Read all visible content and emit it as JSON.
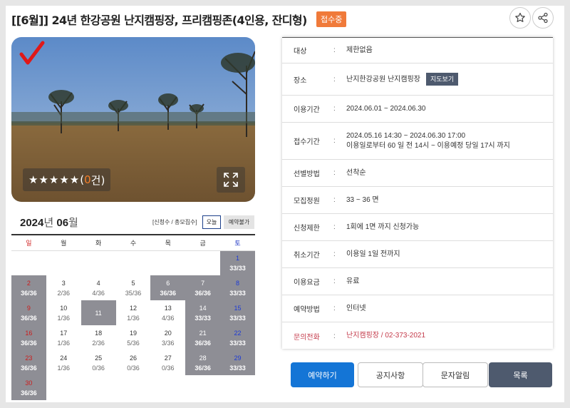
{
  "title": "[[6월]] 24년 한강공원 난지캠핑장, 프리캠핑존(4인용, 잔디형)",
  "status_badge": "접수중",
  "rating": {
    "stars": "★★★★★",
    "open": "(",
    "count": "0",
    "close": " 건)"
  },
  "calendar": {
    "year": "2024",
    "year_suffix": "년",
    "month": "06",
    "month_suffix": "월",
    "legend": "[신청수 / 총모집수]",
    "today_btn": "오늘",
    "unavailable_btn": "예약불가",
    "weekdays": [
      "일",
      "월",
      "화",
      "수",
      "목",
      "금",
      "토"
    ],
    "weeks": [
      [
        {
          "d": "",
          "c": "",
          "g": false
        },
        {
          "d": "",
          "c": "",
          "g": false
        },
        {
          "d": "",
          "c": "",
          "g": false
        },
        {
          "d": "",
          "c": "",
          "g": false
        },
        {
          "d": "",
          "c": "",
          "g": false
        },
        {
          "d": "",
          "c": "",
          "g": false
        },
        {
          "d": "1",
          "c": "33/33",
          "g": true
        }
      ],
      [
        {
          "d": "2",
          "c": "36/36",
          "g": true
        },
        {
          "d": "3",
          "c": "2/36",
          "g": false
        },
        {
          "d": "4",
          "c": "4/36",
          "g": false
        },
        {
          "d": "5",
          "c": "35/36",
          "g": false
        },
        {
          "d": "6",
          "c": "36/36",
          "g": true
        },
        {
          "d": "7",
          "c": "36/36",
          "g": true
        },
        {
          "d": "8",
          "c": "33/33",
          "g": true
        }
      ],
      [
        {
          "d": "9",
          "c": "36/36",
          "g": true
        },
        {
          "d": "10",
          "c": "1/36",
          "g": false
        },
        {
          "d": "11",
          "c": "",
          "g": true
        },
        {
          "d": "12",
          "c": "1/36",
          "g": false
        },
        {
          "d": "13",
          "c": "4/36",
          "g": false
        },
        {
          "d": "14",
          "c": "33/33",
          "g": true
        },
        {
          "d": "15",
          "c": "33/33",
          "g": true
        }
      ],
      [
        {
          "d": "16",
          "c": "36/36",
          "g": true
        },
        {
          "d": "17",
          "c": "1/36",
          "g": false
        },
        {
          "d": "18",
          "c": "2/36",
          "g": false
        },
        {
          "d": "19",
          "c": "5/36",
          "g": false
        },
        {
          "d": "20",
          "c": "3/36",
          "g": false
        },
        {
          "d": "21",
          "c": "36/36",
          "g": true
        },
        {
          "d": "22",
          "c": "33/33",
          "g": true
        }
      ],
      [
        {
          "d": "23",
          "c": "36/36",
          "g": true
        },
        {
          "d": "24",
          "c": "1/36",
          "g": false
        },
        {
          "d": "25",
          "c": "0/36",
          "g": false
        },
        {
          "d": "26",
          "c": "0/36",
          "g": false
        },
        {
          "d": "27",
          "c": "0/36",
          "g": false
        },
        {
          "d": "28",
          "c": "36/36",
          "g": true
        },
        {
          "d": "29",
          "c": "33/33",
          "g": true
        }
      ],
      [
        {
          "d": "30",
          "c": "36/36",
          "g": true
        }
      ]
    ]
  },
  "info": {
    "separator": ":",
    "target_label": "대상",
    "target_value": "제한없음",
    "place_label": "장소",
    "place_value": "난지한강공원 난지캠핑장",
    "map_btn": "지도보기",
    "period_label": "이용기간",
    "period_value": "2024.06.01 ~ 2024.06.30",
    "apply_label": "접수기간",
    "apply_value_1": "2024.05.16 14:30 ~ 2024.06.30 17:00",
    "apply_value_2": "이용일로부터 60 일 전 14시 ~ 이용예정 당일 17시 까지",
    "select_label": "선별방법",
    "select_value": "선착순",
    "capacity_label": "모집정원",
    "capacity_value": "33 ~ 36 면",
    "limit_label": "신청제한",
    "limit_value": "1회에 1면 까지 신청가능",
    "cancel_label": "취소기간",
    "cancel_value": "이용일 1일 전까지",
    "fee_label": "이용요금",
    "fee_value": "유료",
    "method_label": "예약방법",
    "method_value": "인터넷",
    "contact_label": "문의전화",
    "contact_value": "난지캠핑장 / 02-373-2021"
  },
  "buttons": {
    "reserve": "예약하기",
    "notice": "공지사항",
    "sms": "문자알림",
    "list": "목록"
  },
  "colors": {
    "accent_blue": "#1475d6",
    "badge_orange": "#f07a3a",
    "dark_slate": "#4e5a6e",
    "booked_gray": "#8e8e95"
  }
}
